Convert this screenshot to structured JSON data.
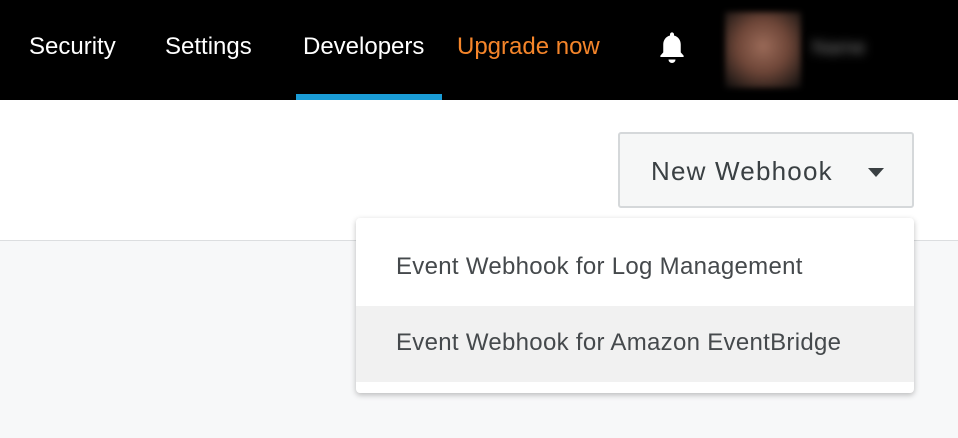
{
  "nav": {
    "items": [
      {
        "label": "Security"
      },
      {
        "label": "Settings"
      },
      {
        "label": "Developers"
      }
    ],
    "upgrade_label": "Upgrade now",
    "bell_icon": "bell-icon",
    "accent_color": "#1a9cd6",
    "upgrade_color": "#f5852a"
  },
  "user": {
    "name": "Name"
  },
  "toolbar": {
    "new_webhook_label": "New Webhook",
    "caret_icon": "caret-down-icon"
  },
  "dropdown": {
    "items": [
      {
        "label": "Event Webhook for Log Management"
      },
      {
        "label": "Event Webhook for Amazon EventBridge"
      }
    ]
  }
}
